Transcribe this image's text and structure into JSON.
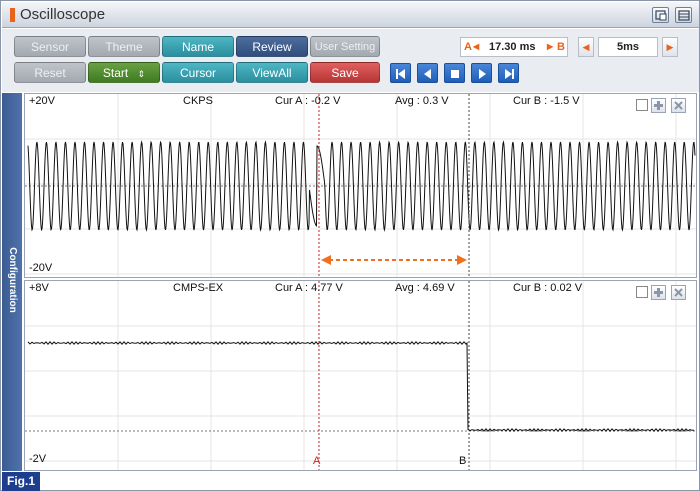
{
  "window": {
    "title": "Oscilloscope"
  },
  "toolbar": {
    "sensor": "Sensor",
    "theme": "Theme",
    "name": "Name",
    "review": "Review",
    "user_setting": "User Setting",
    "reset": "Reset",
    "start": "Start",
    "cursor": "Cursor",
    "viewall": "ViewAll",
    "save": "Save"
  },
  "cursor_delta": {
    "a_label": "A",
    "b_label": "B",
    "value": "17.30 ms"
  },
  "timebase": {
    "value": "5ms"
  },
  "channels": [
    {
      "name": "CKPS",
      "top": "+20V",
      "bottom": "-20V",
      "cur_a": "Cur A : -0.2 V",
      "avg": "Avg : 0.3 V",
      "cur_b": "Cur B : -1.5 V"
    },
    {
      "name": "CMPS-EX",
      "top": "+8V",
      "bottom": "-2V",
      "cur_a": "Cur A : 4.77 V",
      "avg": "Avg : 4.69 V",
      "cur_b": "Cur B : 0.02 V"
    }
  ],
  "cursors": {
    "a": "A",
    "b": "B"
  },
  "sidebar": {
    "label": "Configuration"
  },
  "figure_label": "Fig.1",
  "colors": {
    "accent": "#e8641c",
    "cursor_a": "#cc2222",
    "cursor_b": "#444444",
    "arrow": "#f07020"
  }
}
